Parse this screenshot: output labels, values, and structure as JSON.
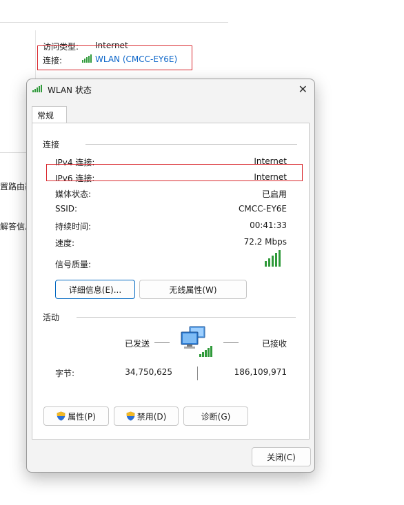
{
  "background": {
    "access_type_label": "访问类型:",
    "access_type_value": "Internet",
    "connection_label": "连接:",
    "connection_value": "WLAN (CMCC-EY6E)",
    "left_cut_1": "置路由器",
    "left_cut_2": "解答信息"
  },
  "dialog": {
    "title": "WLAN 状态",
    "tab": "常规",
    "connection_section": "连接",
    "rows": [
      {
        "label": "IPv4 连接:",
        "value": "Internet"
      },
      {
        "label": "IPv6 连接:",
        "value": "Internet"
      },
      {
        "label": "媒体状态:",
        "value": "已启用"
      },
      {
        "label": "SSID:",
        "value": "CMCC-EY6E"
      },
      {
        "label": "持续时间:",
        "value": "00:41:33"
      },
      {
        "label": "速度:",
        "value": "72.2 Mbps"
      }
    ],
    "signal_label": "信号质量:",
    "signal_bars": 5,
    "details_button": "详细信息(E)...",
    "wireless_props_button": "无线属性(W)",
    "activity_section": "活动",
    "sent_label": "已发送",
    "received_label": "已接收",
    "bytes_label": "字节:",
    "bytes_sent": "34,750,625",
    "bytes_received": "186,109,971",
    "properties_button": "属性(P)",
    "disable_button": "禁用(D)",
    "diagnose_button": "诊断(G)",
    "close_button": "关闭(C)"
  },
  "colors": {
    "highlight_box": "#d9252b",
    "link": "#0a64c8",
    "signal": "#2f9a3a"
  }
}
